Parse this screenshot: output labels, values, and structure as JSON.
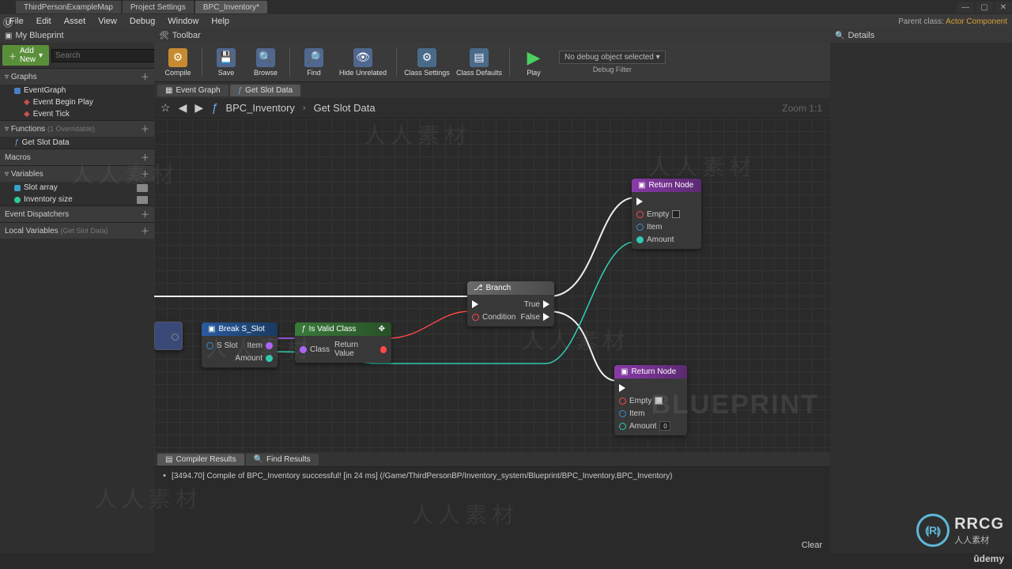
{
  "window": {
    "parent_class_label": "Parent class:",
    "parent_class_value": "Actor Component"
  },
  "editor_tabs": [
    "ThirdPersonExampleMap",
    "Project Settings",
    "BPC_Inventory*"
  ],
  "menubar": [
    "File",
    "Edit",
    "Asset",
    "View",
    "Debug",
    "Window",
    "Help"
  ],
  "left": {
    "panel_title": "My Blueprint",
    "addnew": "Add New",
    "search_placeholder": "Search",
    "sections": {
      "graphs": "Graphs",
      "functions": "Functions",
      "functions_hint": "(1 Overridable)",
      "macros": "Macros",
      "variables": "Variables",
      "dispatchers": "Event Dispatchers",
      "locals": "Local Variables",
      "locals_hint": "(Get Slot Data)"
    },
    "graphs_items": {
      "root": "EventGraph",
      "children": [
        "Event Begin Play",
        "Event Tick"
      ]
    },
    "functions_items": [
      "Get Slot Data"
    ],
    "variables_items": [
      {
        "name": "Slot array",
        "color": "#3aa0c8"
      },
      {
        "name": "Inventory size",
        "color": "#30c896"
      }
    ]
  },
  "toolbar": {
    "label": "Toolbar",
    "buttons": {
      "compile": "Compile",
      "save": "Save",
      "browse": "Browse",
      "find": "Find",
      "hide_unrelated": "Hide Unrelated",
      "class_settings": "Class Settings",
      "class_defaults": "Class Defaults",
      "play": "Play"
    },
    "debug_object": "No debug object selected",
    "debug_filter": "Debug Filter"
  },
  "graph_tabs": [
    "Event Graph",
    "Get Slot Data"
  ],
  "breadcrumb": {
    "root": "BPC_Inventory",
    "leaf": "Get Slot Data",
    "zoom": "Zoom 1:1"
  },
  "nodes": {
    "break": {
      "title": "Break S_Slot",
      "in": "S Slot",
      "out1": "Item",
      "out2": "Amount"
    },
    "isvalid": {
      "title": "Is Valid Class",
      "in": "Class",
      "out": "Return Value"
    },
    "branch": {
      "title": "Branch",
      "cond": "Condition",
      "true": "True",
      "false": "False"
    },
    "return1": {
      "title": "Return Node",
      "empty": "Empty",
      "item": "Item",
      "amount": "Amount"
    },
    "return2": {
      "title": "Return Node",
      "empty": "Empty",
      "item": "Item",
      "amount": "Amount",
      "amount_val": "0"
    }
  },
  "bottom": {
    "tabs": [
      "Compiler Results",
      "Find Results"
    ],
    "log": "[3494.70] Compile of BPC_Inventory successful! [in 24 ms] (/Game/ThirdPersonBP/Inventory_system/Blueprint/BPC_Inventory.BPC_Inventory)",
    "clear": "Clear"
  },
  "right": {
    "title": "Details"
  },
  "branding": {
    "rrcg": "RRCG",
    "rrcg_sub": "人人素材",
    "udemy": "ûdemy",
    "watermark": "BLUEPRINT",
    "cn_wm": "人人素材"
  }
}
